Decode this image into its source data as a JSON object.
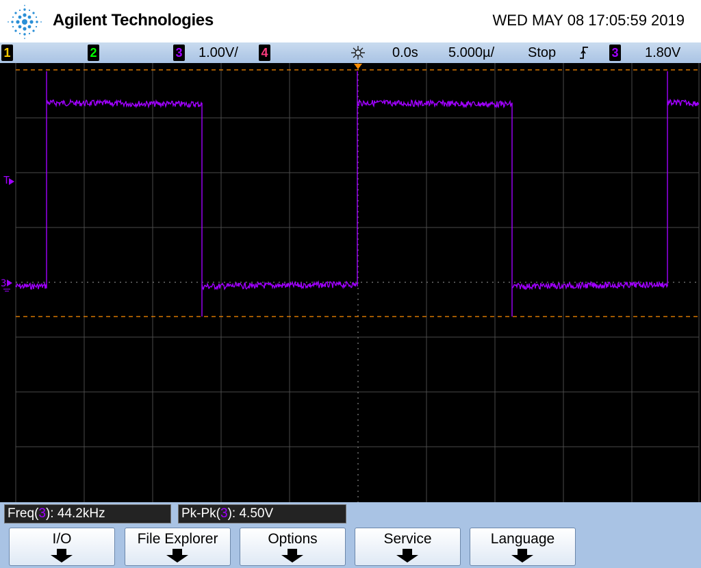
{
  "header": {
    "brand": "Agilent Technologies",
    "datetime": "WED MAY 08 17:05:59 2019"
  },
  "status_bar": {
    "channels": [
      {
        "num": "1",
        "color": "#ffcc00"
      },
      {
        "num": "2",
        "color": "#00ff00"
      },
      {
        "num": "3",
        "color": "#a000ff",
        "scale": "1.00V/"
      },
      {
        "num": "4",
        "color": "#ff3b7f"
      }
    ],
    "time_position": "0.0s",
    "time_scale": "5.000µ/",
    "run_state": "Stop",
    "trigger_slope_icon": "rising-edge-icon",
    "trigger_channel": "3",
    "trigger_level": "1.80V"
  },
  "screen": {
    "trigger_marker": "T",
    "channel_ground_marker": "3",
    "trace_color": "#a000ff",
    "cursor_color": "#ff8c00",
    "grid_color": "#555555"
  },
  "measurements": [
    {
      "label": "Freq(",
      "channel": "3",
      "suffix": "): ",
      "value": "44.2kHz"
    },
    {
      "label": "Pk-Pk(",
      "channel": "3",
      "suffix": "): ",
      "value": "4.50V"
    }
  ],
  "softkeys": [
    {
      "label": "I/O"
    },
    {
      "label": "File Explorer"
    },
    {
      "label": "Options"
    },
    {
      "label": "Service"
    },
    {
      "label": "Language"
    }
  ]
}
